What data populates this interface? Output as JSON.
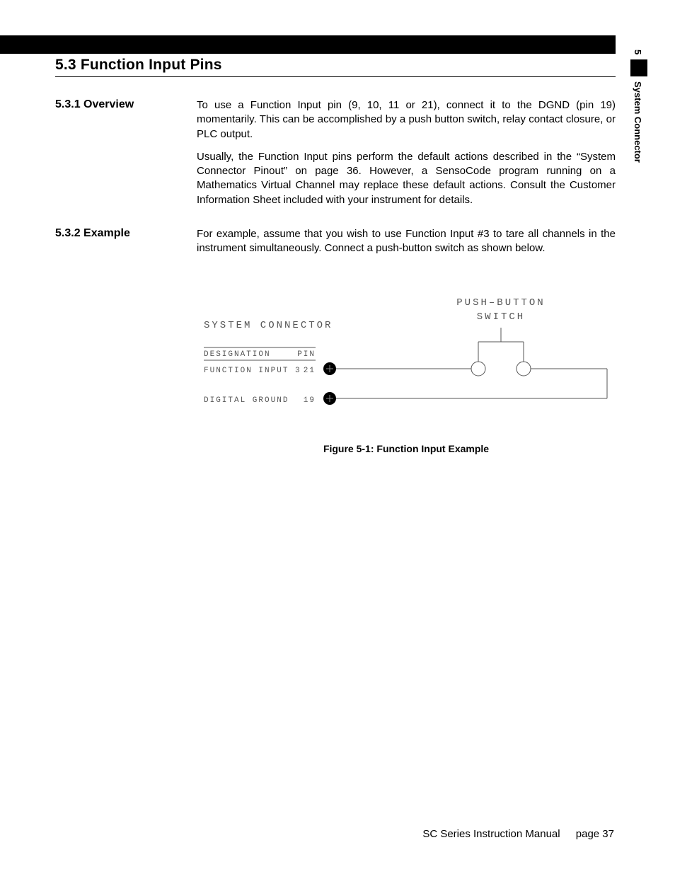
{
  "sideTab": {
    "chapterNum": "5",
    "chapterTitle": "System Connector"
  },
  "section": {
    "number": "5.3",
    "title": "Function Input Pins"
  },
  "subs": {
    "overview": {
      "num": "5.3.1",
      "label": "Overview",
      "p1": "To use a Function Input pin (9, 10, 11 or 21), connect it to the DGND (pin 19) momentarily. This can be accomplished by a push button switch, relay contact closure, or PLC output.",
      "p2": "Usually, the Function Input pins perform the default actions described in the “System Connector Pinout” on page 36.  However, a SensoCode program running on a Mathematics Virtual Channel may replace these default actions.  Consult the Customer Information Sheet included with your instrument for details."
    },
    "example": {
      "num": "5.3.2",
      "label": "Example",
      "p1": "For example, assume that you wish to use Function Input #3 to tare all channels in the instrument simultaneously.  Connect a push-button switch as shown below."
    }
  },
  "diagram": {
    "title": "SYSTEM CONNECTOR",
    "switchLabel1": "PUSH–BUTTON",
    "switchLabel2": "SWITCH",
    "colDesignation": "DESIGNATION",
    "colPin": "PIN",
    "row1Label": "FUNCTION INPUT 3",
    "row1Pin": "21",
    "row2Label": "DIGITAL GROUND",
    "row2Pin": "19"
  },
  "figure": {
    "caption": "Figure 5-1: Function Input Example"
  },
  "footer": {
    "manual": "SC Series Instruction Manual",
    "pageLabel": "page 37"
  }
}
